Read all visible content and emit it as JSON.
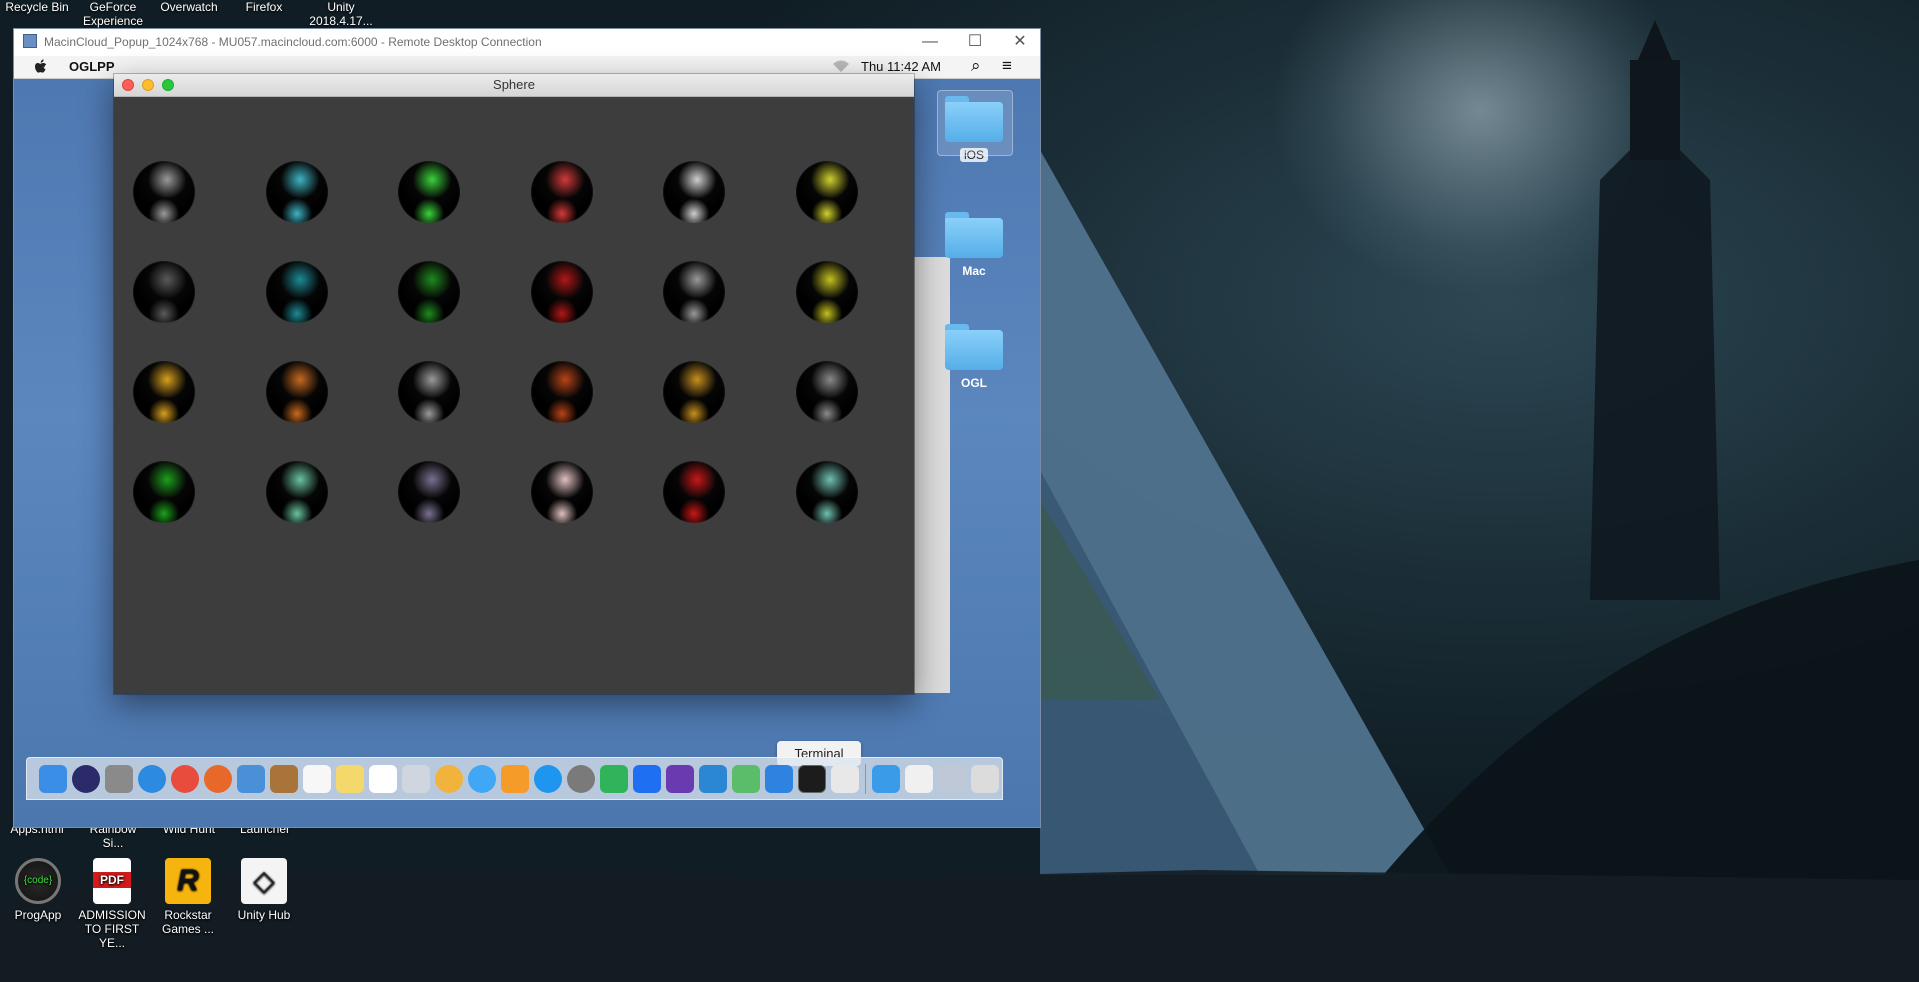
{
  "desktop": {
    "top_icons": [
      {
        "label": "Recycle Bin"
      },
      {
        "label": "GeForce Experience"
      },
      {
        "label": "Overwatch"
      },
      {
        "label": "Firefox"
      },
      {
        "label": "Unity 2018.4.17..."
      }
    ],
    "mid_labels": [
      {
        "label": "Apps.html"
      },
      {
        "label": "Rainbow Si..."
      },
      {
        "label": "Wild Hunt"
      },
      {
        "label": "Launcher"
      }
    ],
    "bottom_icons": [
      {
        "label": "ProgApp",
        "glyph": "{code}"
      },
      {
        "label": "ADMISSION TO FIRST YE...",
        "glyph": "PDF"
      },
      {
        "label": "Rockstar Games ...",
        "glyph": "R"
      },
      {
        "label": "Unity Hub",
        "glyph": "◇"
      }
    ]
  },
  "rdc_window": {
    "title": "MacinCloud_Popup_1024x768 - MU057.macincloud.com:6000 - Remote Desktop Connection",
    "minimize": "—",
    "maximize": "☐",
    "close": "✕"
  },
  "mac_menubar": {
    "apple": "",
    "app_name": "OGLPP",
    "clock": "Thu 11:42 AM",
    "search_icon": "⌕",
    "list_icon": "≡"
  },
  "sphere_window": {
    "title": "Sphere",
    "sphere_colors": [
      [
        "#9a9a9a",
        "#3fb4c4",
        "#3bd23b",
        "#d23a3a",
        "#cfcfcf",
        "#d0d030"
      ],
      [
        "#5a5a5a",
        "#1e8a95",
        "#1f8a1f",
        "#b01818",
        "#9a9a9a",
        "#c4c020"
      ],
      [
        "#d8a020",
        "#c86a20",
        "#9a9a9a",
        "#b84418",
        "#c89020",
        "#8a8a8a"
      ],
      [
        "#1ea01e",
        "#6ac4a0",
        "#7a7090",
        "#e0c0c0",
        "#c81818",
        "#70c0b0"
      ]
    ]
  },
  "folders": [
    {
      "label": "iOS"
    },
    {
      "label": "Mac"
    },
    {
      "label": "OGL"
    }
  ],
  "dock": {
    "tooltip": "Terminal",
    "icon_names": [
      "finder",
      "siri",
      "launchpad",
      "safari",
      "chrome",
      "firefox",
      "preview",
      "notebook",
      "calendar",
      "notes",
      "reminders",
      "files",
      "photos",
      "messages",
      "ibooks",
      "app-store",
      "system-preferences",
      "evernote",
      "dropbox",
      "visual-studio",
      "vscode",
      "android-studio",
      "xcode",
      "terminal",
      "textedit",
      "downloads-stack",
      "documents-stack",
      "migration",
      "trash"
    ],
    "icon_colors": [
      "#3a8ee6",
      "#2b2b6a",
      "#8a8a8a",
      "#2c8ae0",
      "#e84c3d",
      "#e8682a",
      "#4a90d9",
      "#a8743a",
      "#f7f7f7",
      "#f5d86b",
      "#ffffff",
      "#cfd6df",
      "#f2b33d",
      "#3fa7f5",
      "#f59b2a",
      "#1e96f0",
      "#7a7a7a",
      "#2fb45a",
      "#1f6ff2",
      "#6a3bb0",
      "#2b86d4",
      "#5bbd6a",
      "#2f83e0",
      "#1c1c1c",
      "#e8e8e8",
      "#3a9ce8",
      "#f0f0f0",
      "#bfc8d6",
      "#dcdcdc"
    ]
  }
}
